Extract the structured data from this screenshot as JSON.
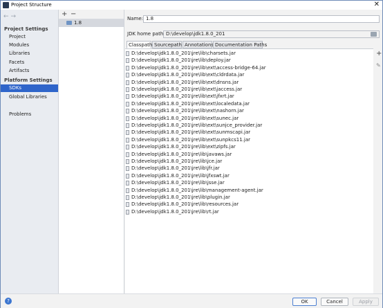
{
  "window": {
    "title": "Project Structure",
    "close_glyph": "✕"
  },
  "nav": {
    "back": "←",
    "forward": "→"
  },
  "sidebar": {
    "project_settings_header": "Project Settings",
    "project_items": [
      "Project",
      "Modules",
      "Libraries",
      "Facets",
      "Artifacts"
    ],
    "platform_settings_header": "Platform Settings",
    "platform_items": [
      "SDKs",
      "Global Libraries"
    ],
    "selected": "SDKs",
    "problems": "Problems"
  },
  "sdk_list": {
    "add": "+",
    "remove": "−",
    "items": [
      "1.8"
    ],
    "selected": "1.8"
  },
  "detail": {
    "name_label": "Name:",
    "name_value": "1.8",
    "home_label": "JDK home path:",
    "home_value": "D:\\develop\\jdk1.8.0_201",
    "tabs": [
      "Classpath",
      "Sourcepath",
      "Annotations",
      "Documentation Paths"
    ],
    "active_tab": "Classpath",
    "classpath": [
      "D:\\develop\\jdk1.8.0_201\\jre\\lib\\charsets.jar",
      "D:\\develop\\jdk1.8.0_201\\jre\\lib\\deploy.jar",
      "D:\\develop\\jdk1.8.0_201\\jre\\lib\\ext\\access-bridge-64.jar",
      "D:\\develop\\jdk1.8.0_201\\jre\\lib\\ext\\cldrdata.jar",
      "D:\\develop\\jdk1.8.0_201\\jre\\lib\\ext\\dnsns.jar",
      "D:\\develop\\jdk1.8.0_201\\jre\\lib\\ext\\jaccess.jar",
      "D:\\develop\\jdk1.8.0_201\\jre\\lib\\ext\\jfxrt.jar",
      "D:\\develop\\jdk1.8.0_201\\jre\\lib\\ext\\localedata.jar",
      "D:\\develop\\jdk1.8.0_201\\jre\\lib\\ext\\nashorn.jar",
      "D:\\develop\\jdk1.8.0_201\\jre\\lib\\ext\\sunec.jar",
      "D:\\develop\\jdk1.8.0_201\\jre\\lib\\ext\\sunjce_provider.jar",
      "D:\\develop\\jdk1.8.0_201\\jre\\lib\\ext\\sunmscapi.jar",
      "D:\\develop\\jdk1.8.0_201\\jre\\lib\\ext\\sunpkcs11.jar",
      "D:\\develop\\jdk1.8.0_201\\jre\\lib\\ext\\zipfs.jar",
      "D:\\develop\\jdk1.8.0_201\\jre\\lib\\javaws.jar",
      "D:\\develop\\jdk1.8.0_201\\jre\\lib\\jce.jar",
      "D:\\develop\\jdk1.8.0_201\\jre\\lib\\jfr.jar",
      "D:\\develop\\jdk1.8.0_201\\jre\\lib\\jfxswt.jar",
      "D:\\develop\\jdk1.8.0_201\\jre\\lib\\jsse.jar",
      "D:\\develop\\jdk1.8.0_201\\jre\\lib\\management-agent.jar",
      "D:\\develop\\jdk1.8.0_201\\jre\\lib\\plugin.jar",
      "D:\\develop\\jdk1.8.0_201\\jre\\lib\\resources.jar",
      "D:\\develop\\jdk1.8.0_201\\jre\\lib\\rt.jar"
    ],
    "add_glyph": "+",
    "edit_glyph": "✎"
  },
  "footer": {
    "help": "?",
    "ok": "OK",
    "cancel": "Cancel",
    "apply": "Apply"
  },
  "colors": {
    "selection": "#2f65ca",
    "sidebar_bg": "#e9ecf1",
    "window_border": "#6e8bb8"
  },
  "icons": {
    "app": "intellij-icon",
    "jar": "jar-file-icon",
    "sdk": "sdk-folder-icon"
  }
}
